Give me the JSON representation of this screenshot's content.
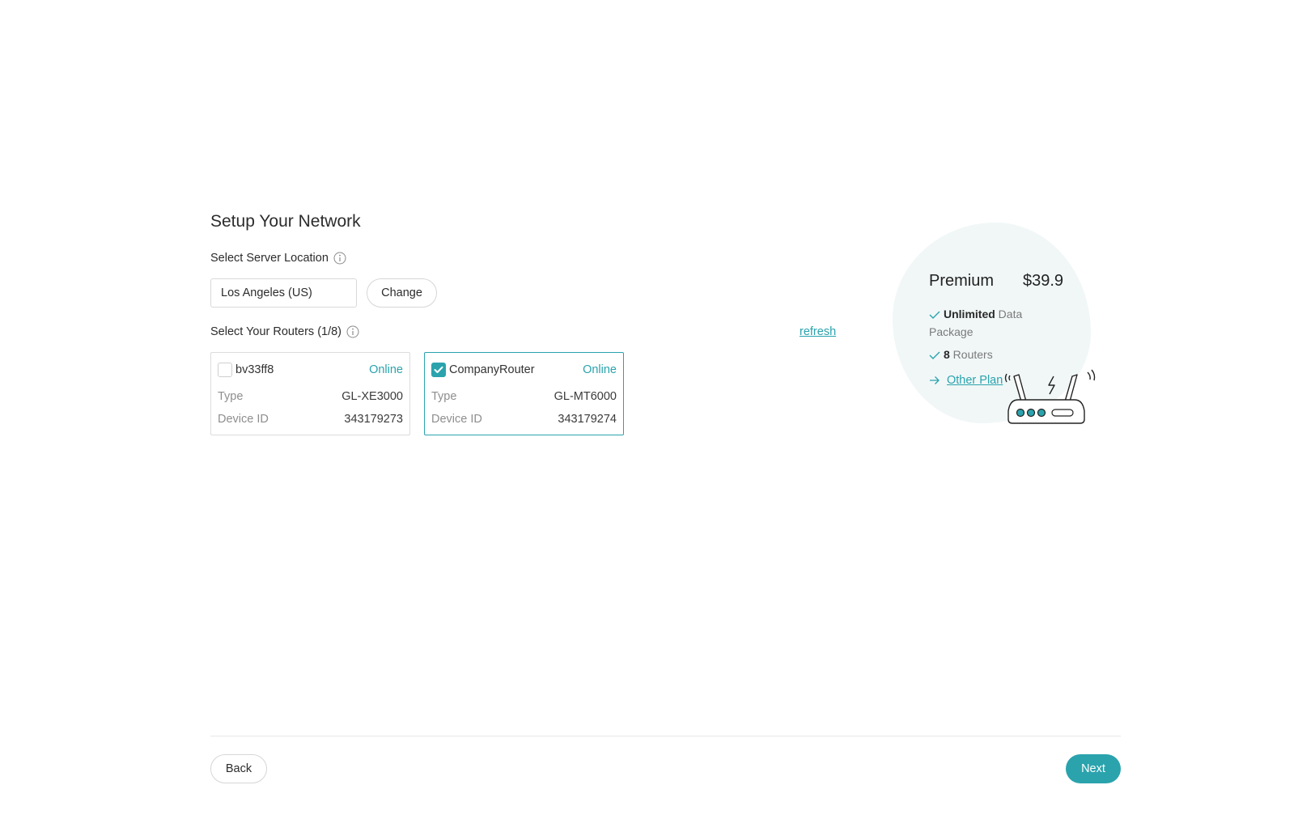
{
  "page": {
    "title": "Setup Your Network"
  },
  "server": {
    "label": "Select Server Location",
    "location_value": "Los Angeles (US)",
    "change_label": "Change"
  },
  "routers": {
    "label": "Select Your Routers (1/8)",
    "refresh_label": "refresh",
    "items": [
      {
        "name": "bv33ff8",
        "status": "Online",
        "selected": false,
        "type_label": "Type",
        "type": "GL-XE3000",
        "id_label": "Device ID",
        "device_id": "343179273"
      },
      {
        "name": "CompanyRouter",
        "status": "Online",
        "selected": true,
        "type_label": "Type",
        "type": "GL-MT6000",
        "id_label": "Device ID",
        "device_id": "343179274"
      }
    ]
  },
  "plan": {
    "name": "Premium",
    "price": "$39.9",
    "feature1_bold": "Unlimited",
    "feature1_text": " Data",
    "feature1_text2": "Package",
    "feature2_bold": "8",
    "feature2_text": " Routers",
    "other_plan_label": "Other Plan"
  },
  "footer": {
    "back_label": "Back",
    "next_label": "Next"
  },
  "colors": {
    "accent": "#2aa3ad",
    "plan_bg": "#f1f7f7"
  }
}
